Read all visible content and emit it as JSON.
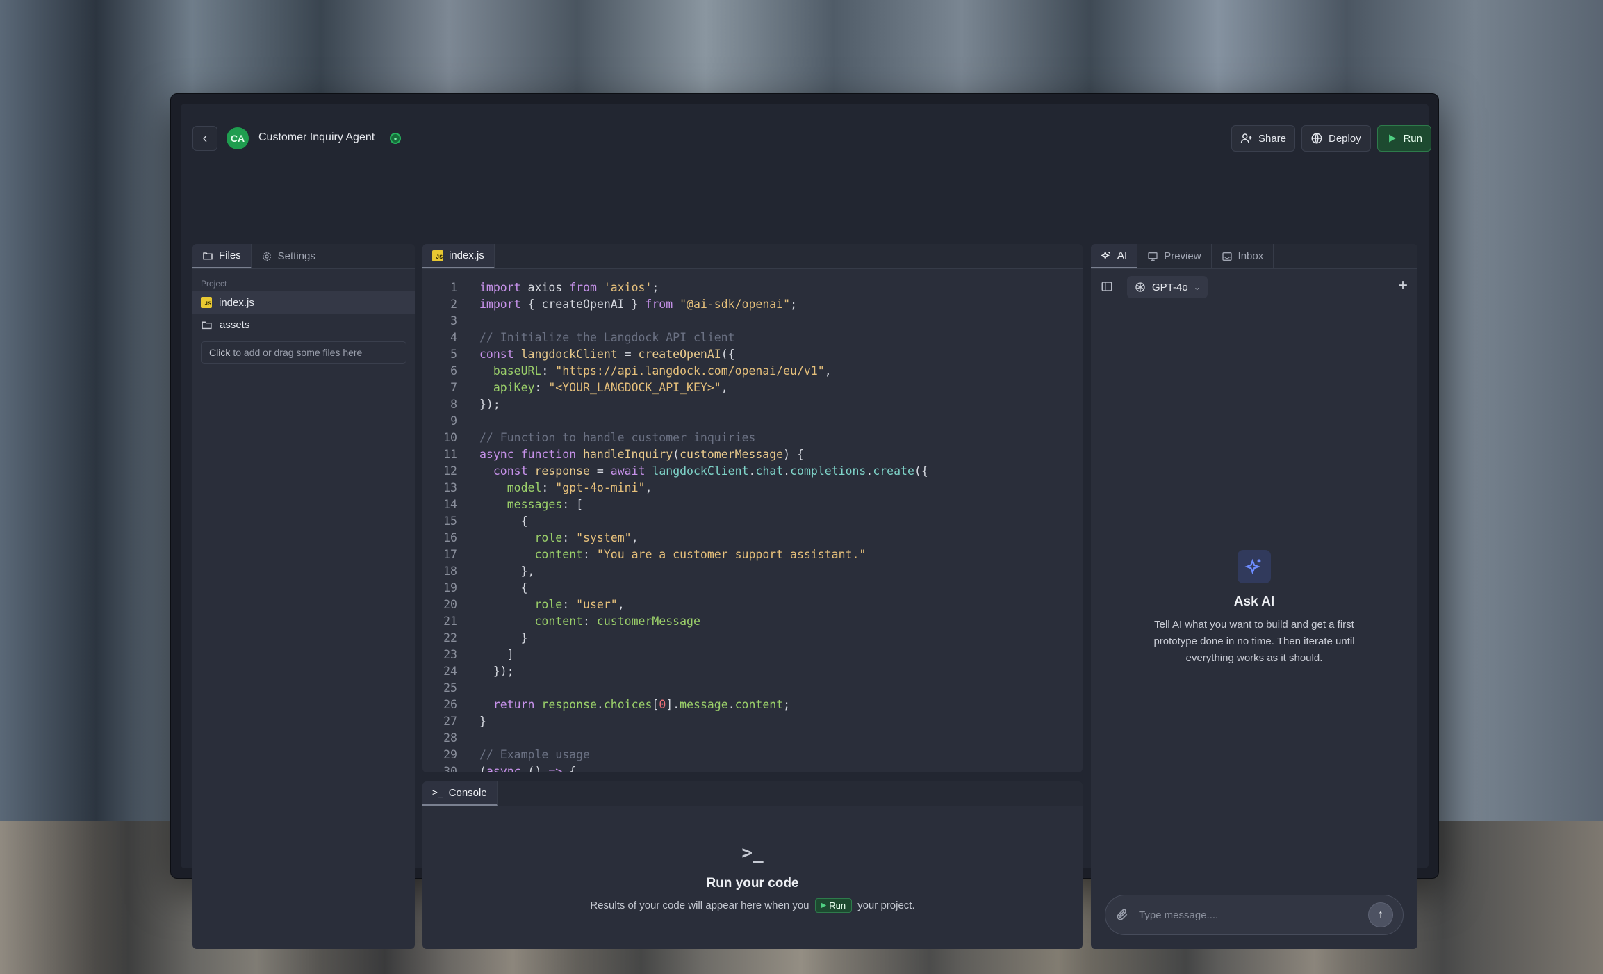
{
  "header": {
    "back_icon": "chevron-left-icon",
    "avatar_initials": "CA",
    "agent_name": "Customer Inquiry Agent",
    "share_label": "Share",
    "deploy_label": "Deploy",
    "run_label": "Run"
  },
  "left_panel": {
    "tabs": [
      {
        "label": "Files"
      },
      {
        "label": "Settings"
      }
    ],
    "section_label": "Project",
    "files": [
      {
        "name": "index.js",
        "icon": "js-file-icon"
      },
      {
        "name": "assets",
        "icon": "folder-icon"
      }
    ],
    "upload_link": "Click",
    "upload_text": "to add or drag some files here"
  },
  "editor": {
    "tab_label": "index.js",
    "lines": [
      [
        [
          "kw",
          "import"
        ],
        [
          "t",
          " axios "
        ],
        [
          "kw",
          "from"
        ],
        [
          "t",
          " "
        ],
        [
          "str",
          "'axios'"
        ],
        [
          "t",
          ";"
        ]
      ],
      [
        [
          "kw",
          "import"
        ],
        [
          "t",
          " { createOpenAI } "
        ],
        [
          "kw",
          "from"
        ],
        [
          "t",
          " "
        ],
        [
          "str",
          "\"@ai-sdk/openai\""
        ],
        [
          "t",
          ";"
        ]
      ],
      [],
      [
        [
          "cm",
          "// Initialize the Langdock API client"
        ]
      ],
      [
        [
          "kw",
          "const"
        ],
        [
          "t",
          " "
        ],
        [
          "fn",
          "langdockClient"
        ],
        [
          "t",
          " = "
        ],
        [
          "fn",
          "createOpenAI"
        ],
        [
          "t",
          "({"
        ]
      ],
      [
        [
          "t",
          "  "
        ],
        [
          "prop",
          "baseURL"
        ],
        [
          "t",
          ": "
        ],
        [
          "str",
          "\"https://api.langdock.com/openai/eu/v1\""
        ],
        [
          "t",
          ","
        ]
      ],
      [
        [
          "t",
          "  "
        ],
        [
          "prop",
          "apiKey"
        ],
        [
          "t",
          ": "
        ],
        [
          "str",
          "\"<YOUR_LANGDOCK_API_KEY>\""
        ],
        [
          "t",
          ","
        ]
      ],
      [
        [
          "t",
          "});"
        ]
      ],
      [],
      [
        [
          "cm",
          "// Function to handle customer inquiries"
        ]
      ],
      [
        [
          "kw",
          "async function"
        ],
        [
          "t",
          " "
        ],
        [
          "fn",
          "handleInquiry"
        ],
        [
          "t",
          "("
        ],
        [
          "fn",
          "customerMessage"
        ],
        [
          "t",
          ") {"
        ]
      ],
      [
        [
          "t",
          "  "
        ],
        [
          "kw",
          "const"
        ],
        [
          "t",
          " "
        ],
        [
          "fn",
          "response"
        ],
        [
          "t",
          " = "
        ],
        [
          "kw",
          "await"
        ],
        [
          "t",
          " "
        ],
        [
          "mem",
          "langdockClient"
        ],
        [
          "t",
          "."
        ],
        [
          "mem",
          "chat"
        ],
        [
          "t",
          "."
        ],
        [
          "mem",
          "completions"
        ],
        [
          "t",
          "."
        ],
        [
          "mem",
          "create"
        ],
        [
          "t",
          "({"
        ]
      ],
      [
        [
          "t",
          "    "
        ],
        [
          "prop",
          "model"
        ],
        [
          "t",
          ": "
        ],
        [
          "str",
          "\"gpt-4o-mini\""
        ],
        [
          "t",
          ","
        ]
      ],
      [
        [
          "t",
          "    "
        ],
        [
          "prop",
          "messages"
        ],
        [
          "t",
          ": ["
        ]
      ],
      [
        [
          "t",
          "      {"
        ]
      ],
      [
        [
          "t",
          "        "
        ],
        [
          "prop",
          "role"
        ],
        [
          "t",
          ": "
        ],
        [
          "str",
          "\"system\""
        ],
        [
          "t",
          ","
        ]
      ],
      [
        [
          "t",
          "        "
        ],
        [
          "prop",
          "content"
        ],
        [
          "t",
          ": "
        ],
        [
          "str",
          "\"You are a customer support assistant.\""
        ]
      ],
      [
        [
          "t",
          "      },"
        ]
      ],
      [
        [
          "t",
          "      {"
        ]
      ],
      [
        [
          "t",
          "        "
        ],
        [
          "prop",
          "role"
        ],
        [
          "t",
          ": "
        ],
        [
          "str",
          "\"user\""
        ],
        [
          "t",
          ","
        ]
      ],
      [
        [
          "t",
          "        "
        ],
        [
          "prop",
          "content"
        ],
        [
          "t",
          ": "
        ],
        [
          "prop",
          "customerMessage"
        ]
      ],
      [
        [
          "t",
          "      }"
        ]
      ],
      [
        [
          "t",
          "    ]"
        ]
      ],
      [
        [
          "t",
          "  });"
        ]
      ],
      [],
      [
        [
          "t",
          "  "
        ],
        [
          "kw",
          "return"
        ],
        [
          "t",
          " "
        ],
        [
          "prop",
          "response"
        ],
        [
          "t",
          "."
        ],
        [
          "prop",
          "choices"
        ],
        [
          "t",
          "["
        ],
        [
          "num",
          "0"
        ],
        [
          "t",
          "]."
        ],
        [
          "prop",
          "message"
        ],
        [
          "t",
          "."
        ],
        [
          "prop",
          "content"
        ],
        [
          "t",
          ";"
        ]
      ],
      [
        [
          "t",
          "}"
        ]
      ],
      [],
      [
        [
          "cm",
          "// Example usage"
        ]
      ],
      [
        [
          "t",
          "("
        ],
        [
          "kw",
          "async"
        ],
        [
          "t",
          " () "
        ],
        [
          "kw",
          "=>"
        ],
        [
          "t",
          " {"
        ]
      ]
    ]
  },
  "console": {
    "tab_label": "Console",
    "title": "Run your code",
    "desc_before": "Results of your code will appear here when you",
    "run_label": "Run",
    "desc_after": "your project."
  },
  "right_panel": {
    "tabs": [
      {
        "label": "AI"
      },
      {
        "label": "Preview"
      },
      {
        "label": "Inbox"
      }
    ],
    "model": "GPT-4o",
    "ask_title": "Ask AI",
    "ask_desc": "Tell AI what you want to build and get a first prototype done in no time. Then iterate until everything works as it should.",
    "message_placeholder": "Type message...."
  },
  "colors": {
    "accent_green": "#1d4a30",
    "status_green": "#25b35d",
    "ai_icon_blue": "#6d8cff"
  }
}
